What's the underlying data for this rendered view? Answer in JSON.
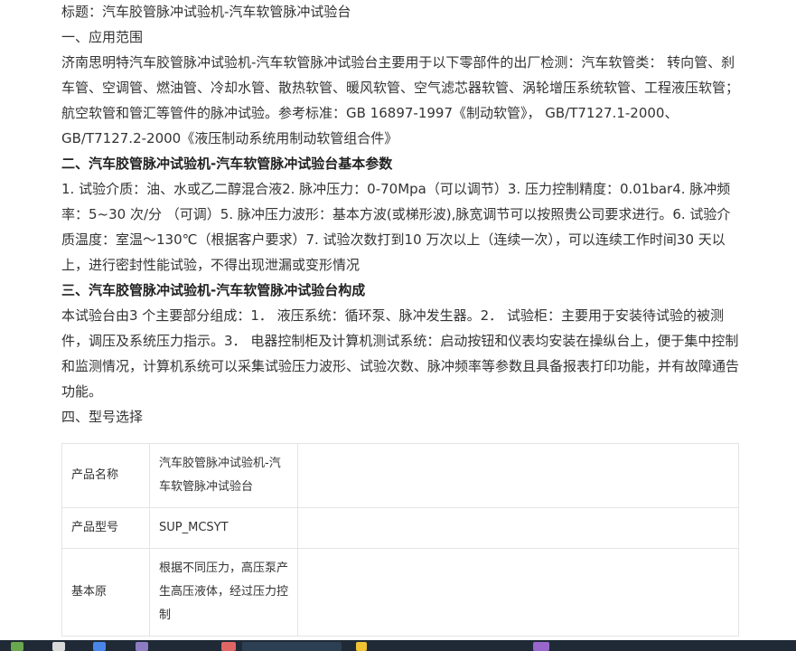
{
  "title_line": "标题：汽车胶管脉冲试验机-汽车软管脉冲试验台",
  "section1": {
    "heading": "一、应用范围",
    "paragraph": "济南思明特汽车胶管脉冲试验机-汽车软管脉冲试验台主要用于以下零部件的出厂检测：汽车软管类： 转向管、刹车管、空调管、燃油管、冷却水管、散热软管、暖风软管、空气滤芯器软管、涡轮增压系统软管、工程液压软管；航空软管和管汇等管件的脉冲试验。参考标准：GB 16897-1997《制动软管》， GB/T7127.1-2000、GB/T7127.2-2000《液压制动系统用制动软管组合件》"
  },
  "section2": {
    "heading": "二、汽车胶管脉冲试验机-汽车软管脉冲试验台基本参数",
    "paragraph": "1. 试验介质：油、水或乙二醇混合液2. 脉冲压力：0-70Mpa（可以调节）3. 压力控制精度：0.01bar4. 脉冲频率：5~30 次/分 （可调）5. 脉冲压力波形：基本方波(或梯形波),脉宽调节可以按照贵公司要求进行。6. 试验介质温度：室温～130℃（根据客户要求）7. 试验次数打到10 万次以上（连续一次），可以连续工作时间30 天以上，进行密封性能试验，不得出现泄漏或变形情况"
  },
  "section3": {
    "heading": "三、汽车胶管脉冲试验机-汽车软管脉冲试验台构成",
    "paragraph": "本试验台由3 个主要部分组成：1． 液压系统：循环泵、脉冲发生器。2． 试验柜：主要用于安装待试验的被测件，调压及系统压力指示。3． 电器控制柜及计算机测试系统：启动按钮和仪表均安装在操纵台上，便于集中控制和监测情况，计算机系统可以采集试验压力波形、试验次数、脉冲频率等参数且具备报表打印功能，并有故障通告功能。"
  },
  "section4": {
    "heading": "四、型号选择"
  },
  "table": {
    "rows": [
      {
        "label": "产品名称",
        "value": "汽车胶管脉冲试验机-汽车软管脉冲试验台",
        "extra": ""
      },
      {
        "label": "产品型号",
        "value": "SUP_MCSYT",
        "extra": ""
      },
      {
        "label": "基本原",
        "value": "根据不同压力，高压泵产生高压液体，经过压力控制",
        "extra": ""
      }
    ]
  },
  "colors": {
    "text": "#333333",
    "border": "#e4e4e4",
    "taskbar": "#1f2a36"
  }
}
